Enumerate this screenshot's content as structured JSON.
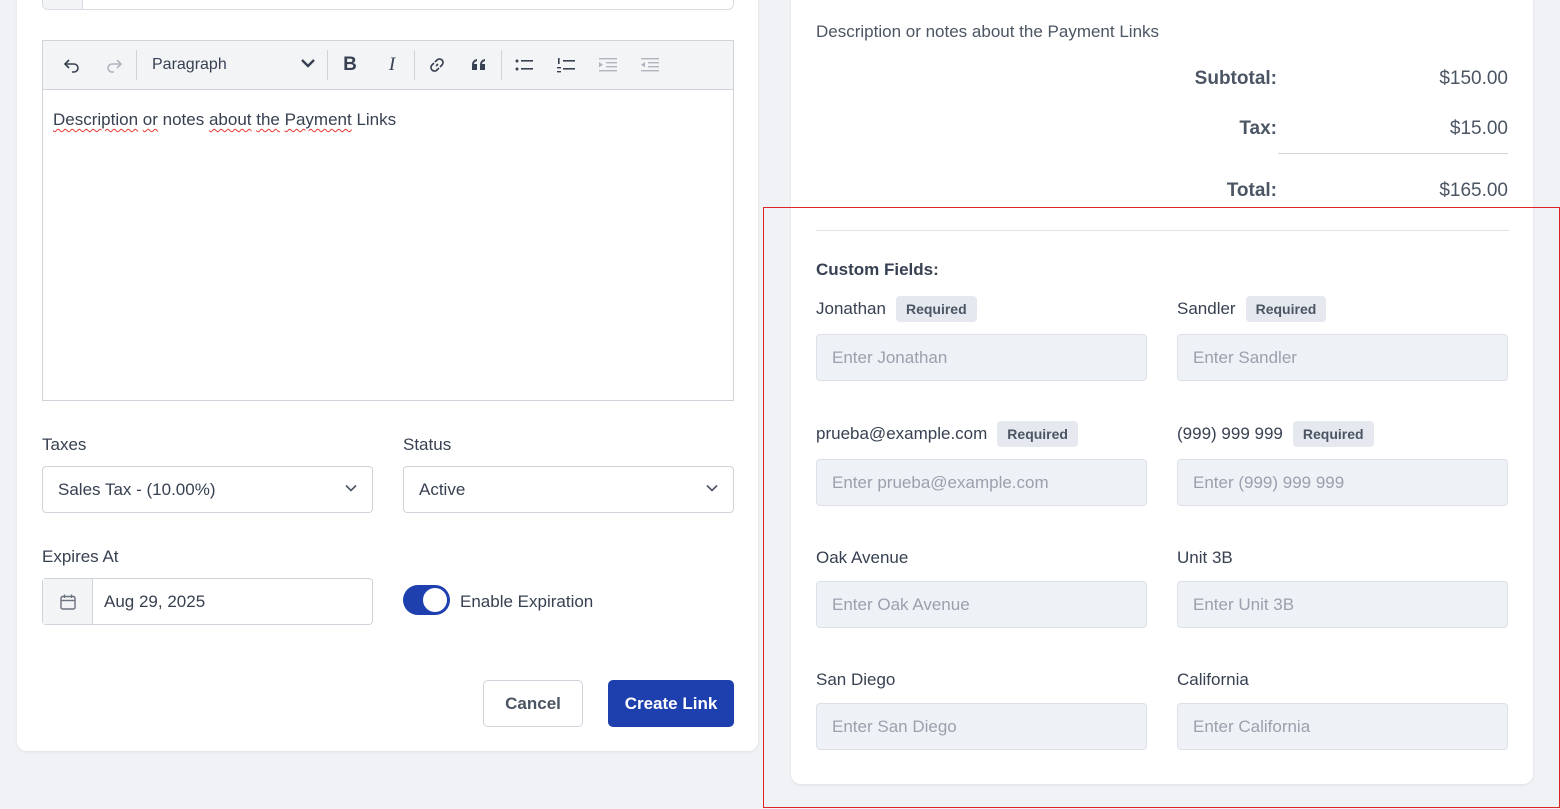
{
  "editor": {
    "block_format": "Paragraph",
    "content_words": [
      "Description",
      "or",
      "notes",
      "about",
      "the",
      "Payment",
      "Links"
    ],
    "toolbar": [
      "undo-icon",
      "redo-icon",
      "bold-icon",
      "italic-icon",
      "link-icon",
      "quote-icon",
      "bulleted-list-icon",
      "numbered-list-icon",
      "indent-icon",
      "outdent-icon"
    ],
    "bold_glyph": "B",
    "italic_glyph": "I"
  },
  "form": {
    "taxes_label": "Taxes",
    "taxes_value": "Sales Tax - (10.00%)",
    "status_label": "Status",
    "status_value": "Active",
    "expires_label": "Expires At",
    "expires_value": "Aug 29, 2025",
    "enable_expiration_label": "Enable Expiration",
    "enable_expiration_on": true,
    "cancel_label": "Cancel",
    "create_label": "Create Link"
  },
  "preview": {
    "description": "Description or notes about the Payment Links",
    "subtotal_label": "Subtotal:",
    "subtotal_value": "$150.00",
    "tax_label": "Tax:",
    "tax_value": "$15.00",
    "total_label": "Total:",
    "total_value": "$165.00",
    "custom_fields_title": "Custom Fields:",
    "required_badge": "Required",
    "fields": [
      {
        "label": "Jonathan",
        "placeholder": "Enter Jonathan",
        "required": true
      },
      {
        "label": "Sandler",
        "placeholder": "Enter Sandler",
        "required": true
      },
      {
        "label": "prueba@example.com",
        "placeholder": "Enter prueba@example.com",
        "required": true
      },
      {
        "label": "(999) 999 999",
        "placeholder": "Enter (999) 999 999",
        "required": true
      },
      {
        "label": "Oak Avenue",
        "placeholder": "Enter Oak Avenue",
        "required": false
      },
      {
        "label": "Unit 3B",
        "placeholder": "Enter Unit 3B",
        "required": false
      },
      {
        "label": "San Diego",
        "placeholder": "Enter San Diego",
        "required": false
      },
      {
        "label": "California",
        "placeholder": "Enter California",
        "required": false
      }
    ]
  },
  "colors": {
    "primary": "#1e40af",
    "highlight_border": "#dc2626"
  }
}
